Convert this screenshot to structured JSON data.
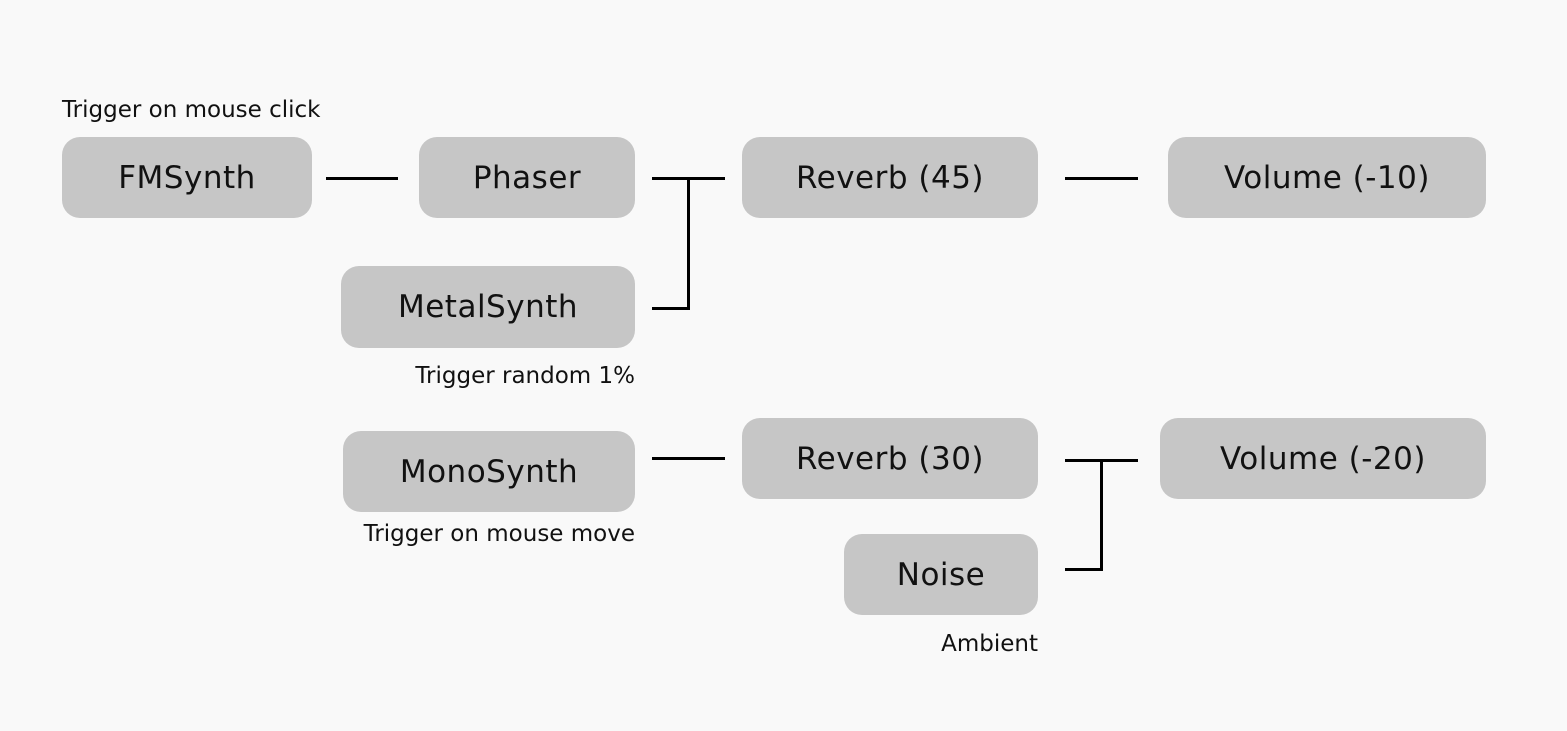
{
  "nodes": {
    "fmsynth": "FMSynth",
    "phaser": "Phaser",
    "reverb45": "Reverb (45)",
    "volume10": "Volume (-10)",
    "metalsynth": "MetalSynth",
    "monosynth": "MonoSynth",
    "reverb30": "Reverb (30)",
    "volume20": "Volume (-20)",
    "noise": "Noise"
  },
  "labels": {
    "fmsynth": "Trigger on mouse click",
    "metalsynth": "Trigger random 1%",
    "monosynth": "Trigger on mouse move",
    "noise": "Ambient"
  },
  "colors": {
    "node_fill": "#c6c6c6",
    "background": "#f9f9f9",
    "connector": "#000000"
  }
}
